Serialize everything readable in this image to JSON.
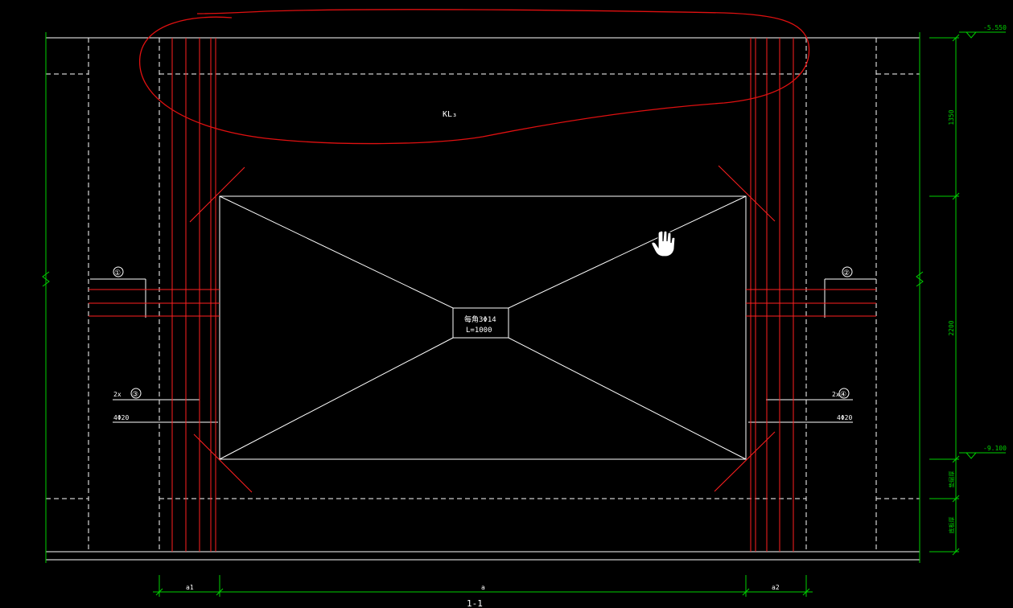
{
  "drawing": {
    "beam_label": "KL₃",
    "opening_note_line1": "每角3Φ14",
    "opening_note_line2": "L=1000",
    "callout_left_top": "①",
    "callout_right_top": "②",
    "callout_left_mid_prefix": "2x",
    "callout_left_mid": "③",
    "callout_right_mid_prefix": "2x",
    "callout_right_mid": "④",
    "rebar_left": "4Φ20",
    "rebar_right": "4Φ20",
    "elev_top": "-5.550",
    "elev_bottom": "-9.100",
    "dim_v_1": "1350",
    "dim_v_2": "2200",
    "dim_v_3": "垫层厚",
    "dim_v_4": "底板厚",
    "dim_h_1": "a1",
    "dim_h_2": "a",
    "dim_h_3": "a2",
    "section_label": "1-1"
  },
  "colors": {
    "background": "#000000",
    "outline": "#ffffff",
    "rebar": "#ff2020",
    "dimension": "#00e000",
    "cloud": "#e01010"
  },
  "cursor": {
    "icon": "hand-pointer-icon"
  }
}
